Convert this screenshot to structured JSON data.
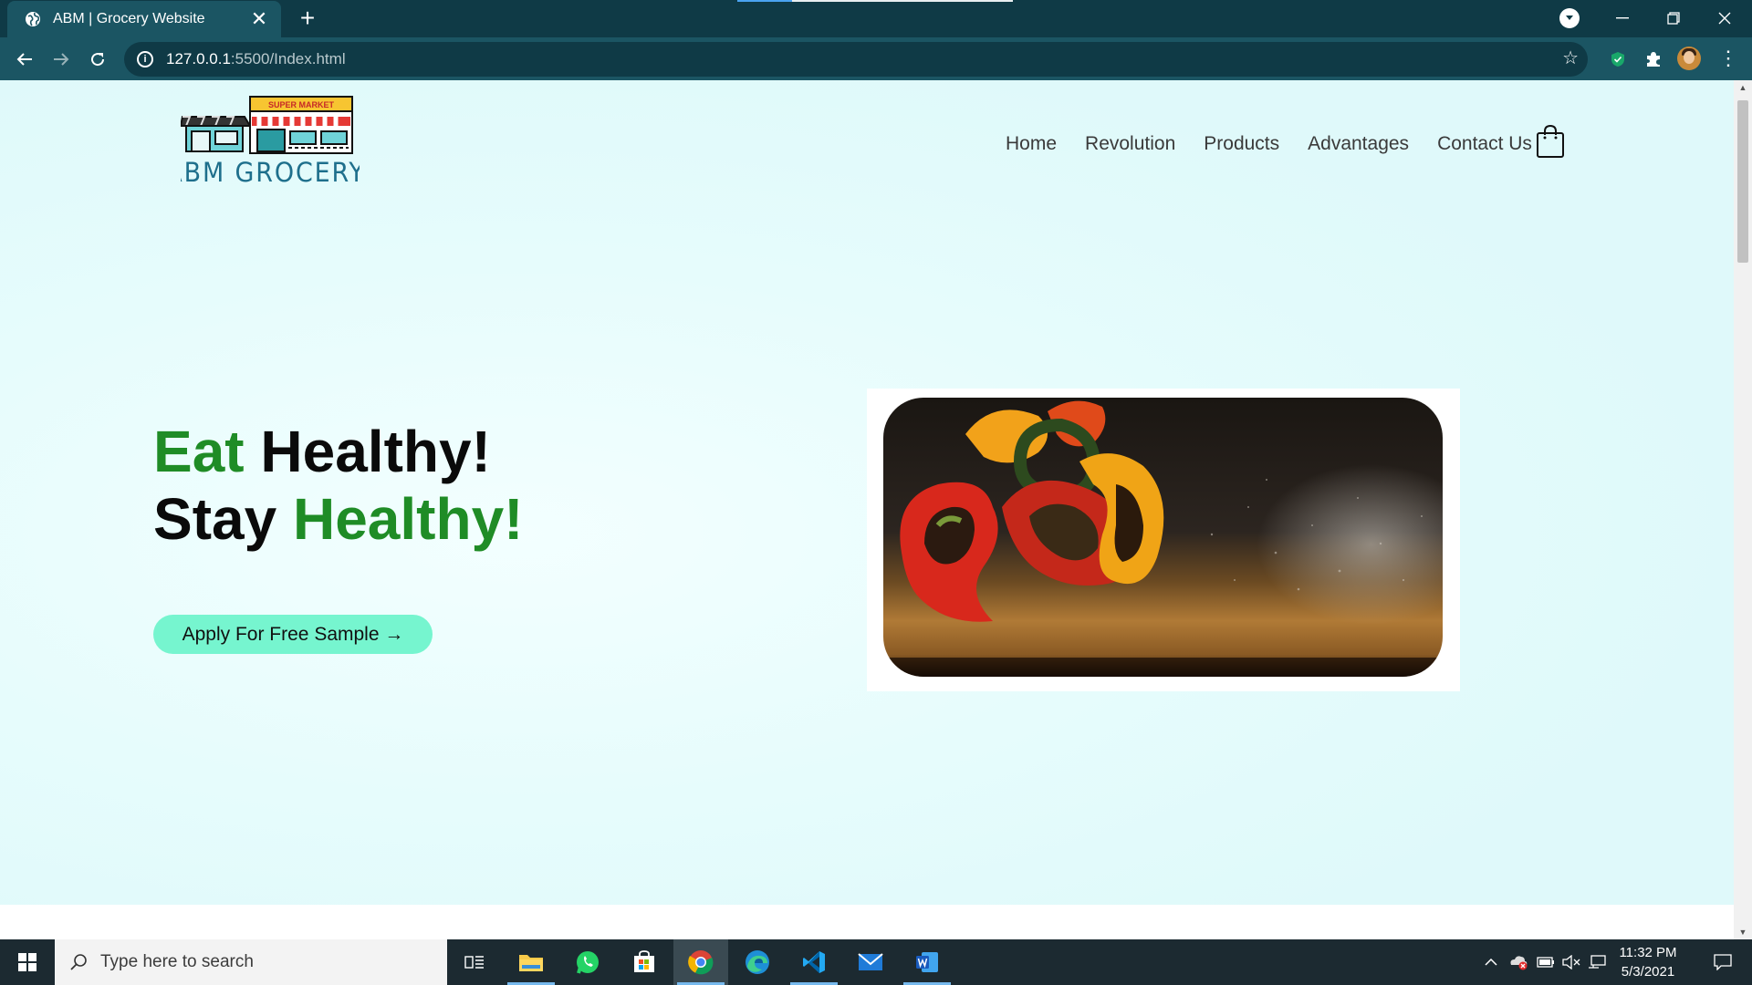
{
  "browser": {
    "tab_title": "ABM | Grocery Website",
    "url_host": "127.0.0.1",
    "url_rest": ":5500/Index.html",
    "icons": {
      "favicon": "globe-icon",
      "back": "back-arrow-icon",
      "forward": "forward-arrow-icon",
      "reload": "reload-icon",
      "info": "info-icon",
      "bookmark": "star-icon",
      "extensions": [
        "shield-extension-icon",
        "puzzle-icon"
      ],
      "menu": "kebab-icon"
    }
  },
  "site": {
    "logo_sign": "SUPER MARKET",
    "logo_text": "ABM GROCERY",
    "nav": [
      "Home",
      "Revolution",
      "Products",
      "Advantages",
      "Contact Us"
    ],
    "hero": {
      "line1_green": "Eat",
      "line1_rest": "Healthy!",
      "line2_rest": "Stay",
      "line2_green": "Healthy!"
    },
    "cta_label": "Apply For Free Sample →",
    "colors": {
      "accent_green": "#1f8c26",
      "cta_bg": "#76f5cf",
      "page_bg": "#e6fcfc"
    }
  },
  "taskbar": {
    "search_placeholder": "Type here to search",
    "apps": [
      "task-view-icon",
      "file-explorer-icon",
      "whatsapp-icon",
      "store-icon",
      "chrome-icon",
      "edge-icon",
      "vscode-icon",
      "mail-icon",
      "word-icon"
    ],
    "time": "11:32 PM",
    "date": "5/3/2021"
  }
}
